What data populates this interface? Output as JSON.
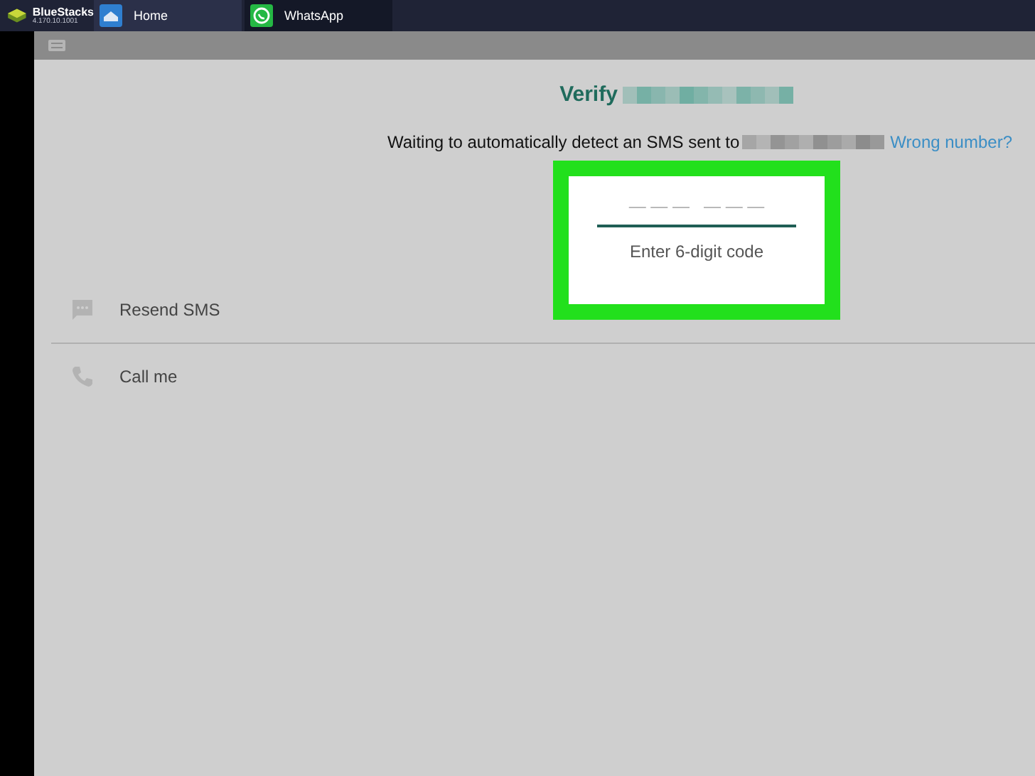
{
  "app": {
    "name": "BlueStacks",
    "version": "4.170.10.1001"
  },
  "tabs": [
    {
      "label": "Home",
      "kind": "home",
      "selected": false
    },
    {
      "label": "WhatsApp",
      "kind": "whatsapp",
      "selected": true
    }
  ],
  "title": "Verify",
  "message": "Waiting to automatically detect an SMS sent to",
  "wrong_number_link": "Wrong number?",
  "code_field": {
    "placeholder": "— — —   — — —",
    "hint": "Enter 6-digit code"
  },
  "options": [
    {
      "label": "Resend SMS",
      "kind": "sms"
    },
    {
      "label": "Call me",
      "kind": "call"
    }
  ]
}
